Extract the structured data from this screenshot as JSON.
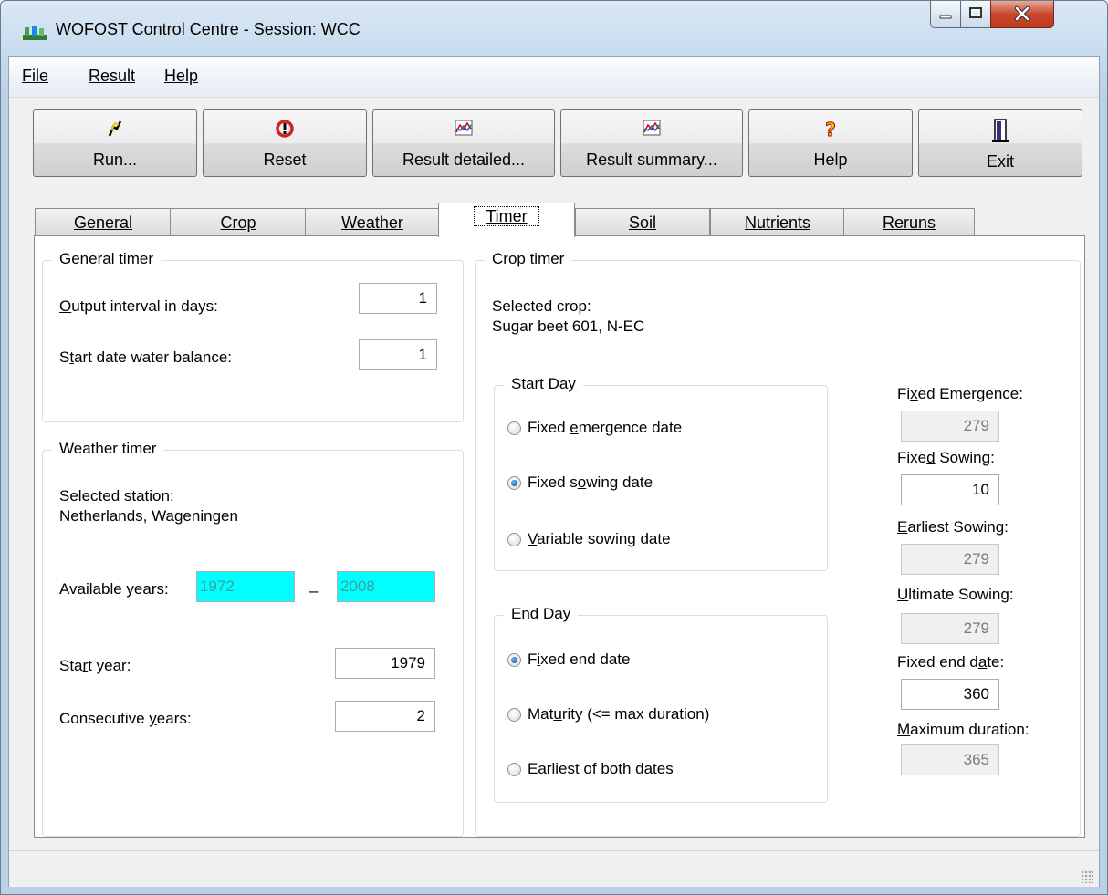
{
  "window": {
    "title": "WOFOST Control Centre - Session: WCC"
  },
  "menu": [
    "File",
    "Result",
    "Help"
  ],
  "toolbar": {
    "run": "Run...",
    "reset": "Reset",
    "result_detailed": "Result detailed...",
    "result_summary": "Result summary...",
    "help": "Help",
    "exit": "Exit"
  },
  "tabs": [
    "General",
    "Crop",
    "Weather",
    "Timer",
    "Soil",
    "Nutrients",
    "Reruns"
  ],
  "active_tab": "Timer",
  "general_timer": {
    "title": "General timer",
    "output_interval_label": "Output interval in days:",
    "output_interval_value": "1",
    "start_date_wb_label": "Start date water balance:",
    "start_date_wb_value": "1"
  },
  "weather_timer": {
    "title": "Weather timer",
    "selected_station_label": "Selected station:",
    "selected_station_value": "Netherlands, Wageningen",
    "available_years_label": "Available years:",
    "year_from": "1972",
    "year_dash": "–",
    "year_to": "2008",
    "start_year_label": "Start year:",
    "start_year_value": "1979",
    "consecutive_years_label": "Consecutive years:",
    "consecutive_years_value": "2"
  },
  "crop_timer": {
    "title": "Crop timer",
    "selected_crop_label": "Selected crop:",
    "selected_crop_value": "Sugar beet 601, N-EC",
    "start_day": {
      "title": "Start Day",
      "options": [
        "Fixed emergence date",
        "Fixed sowing date",
        "Variable sowing date"
      ],
      "selected": 1
    },
    "end_day": {
      "title": "End Day",
      "options": [
        "Fixed end date",
        "Maturity (<= max duration)",
        "Earliest of both dates"
      ],
      "selected": 0
    },
    "fixed_emergence_label": "Fixed Emergence:",
    "fixed_emergence_value": "279",
    "fixed_sowing_label": "Fixed Sowing:",
    "fixed_sowing_value": "10",
    "earliest_sowing_label": "Earliest Sowing:",
    "earliest_sowing_value": "279",
    "ultimate_sowing_label": "Ultimate Sowing:",
    "ultimate_sowing_value": "279",
    "fixed_end_date_label": "Fixed end date:",
    "fixed_end_date_value": "360",
    "maximum_duration_label": "Maximum duration:",
    "maximum_duration_value": "365"
  },
  "status": {
    "text": ""
  }
}
